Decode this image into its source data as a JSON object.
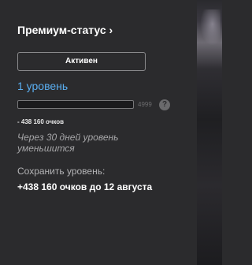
{
  "premium": {
    "title": "Премиум-статус ›",
    "status_button": "Активен",
    "level_label": "1 уровень",
    "progress": {
      "max_label": "4999",
      "fraction": 0.0
    },
    "help_icon": "question-mark-icon",
    "help_glyph": "?",
    "points_delta": "- 438 160 очков",
    "decrease_warning": "Через 30 дней уровень уменьшится",
    "keep_level_label": "Сохранить уровень:",
    "keep_level_value": "+438 160 очков до 12 августа"
  },
  "colors": {
    "accent": "#5aaef0",
    "panel_bg": "#2b2b2d",
    "text_primary": "#ffffff",
    "text_muted": "#a6a6a8"
  }
}
